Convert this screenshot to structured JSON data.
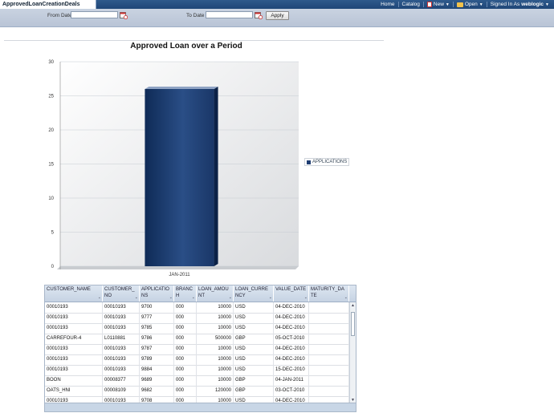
{
  "app": {
    "tab_title": "ApprovedLoanCreationDeals"
  },
  "topnav": {
    "home": "Home",
    "catalog": "Catalog",
    "new": "New",
    "open": "Open",
    "signed_in_as": "Signed In As",
    "user": "weblogic"
  },
  "filters": {
    "from_label": "From Date",
    "from_value": "",
    "to_label": "To Date",
    "to_value": "",
    "apply_label": "Apply"
  },
  "chart_data": {
    "type": "bar",
    "title": "Approved Loan over a Period",
    "categories": [
      "JAN-2011"
    ],
    "series": [
      {
        "name": "APPLICATIONS",
        "values": [
          26
        ]
      }
    ],
    "ylim": [
      0,
      30
    ],
    "yticks": [
      0,
      5,
      10,
      15,
      20,
      25,
      30
    ],
    "xlabel": "",
    "ylabel": "",
    "grid": true,
    "legend": "right",
    "color": "#1f3e72"
  },
  "table": {
    "columns": [
      "CUSTOMER_NAME",
      "CUSTOMER_NO",
      "APPLICATIONS",
      "BRANCH",
      "LOAN_AMOUNT",
      "LOAN_CURRENCY",
      "VALUE_DATE",
      "MATURITY_DATE"
    ],
    "rows": [
      [
        "00010193",
        "00010193",
        "9700",
        "000",
        "10000",
        "USD",
        "04-DEC-2010",
        ""
      ],
      [
        "00010193",
        "00010193",
        "9777",
        "000",
        "10000",
        "USD",
        "04-DEC-2010",
        ""
      ],
      [
        "00010193",
        "00010193",
        "9785",
        "000",
        "10000",
        "USD",
        "04-DEC-2010",
        ""
      ],
      [
        "CARREFOUR-4",
        "L0110881",
        "9786",
        "000",
        "500000",
        "GBP",
        "05-OCT-2010",
        ""
      ],
      [
        "00010193",
        "00010193",
        "9787",
        "000",
        "10000",
        "USD",
        "04-DEC-2010",
        ""
      ],
      [
        "00010193",
        "00010193",
        "9789",
        "000",
        "10000",
        "USD",
        "04-DEC-2010",
        ""
      ],
      [
        "00010193",
        "00010193",
        "9884",
        "000",
        "10000",
        "USD",
        "15-DEC-2010",
        ""
      ],
      [
        "BOON",
        "00008377",
        "9689",
        "000",
        "10000",
        "GBP",
        "04-JAN-2011",
        ""
      ],
      [
        "OATS_HNI",
        "00008109",
        "9682",
        "000",
        "120000",
        "GBP",
        "03-OCT-2010",
        ""
      ],
      [
        "00010193",
        "00010193",
        "9708",
        "000",
        "10000",
        "USD",
        "04-DEC-2010",
        ""
      ]
    ]
  }
}
